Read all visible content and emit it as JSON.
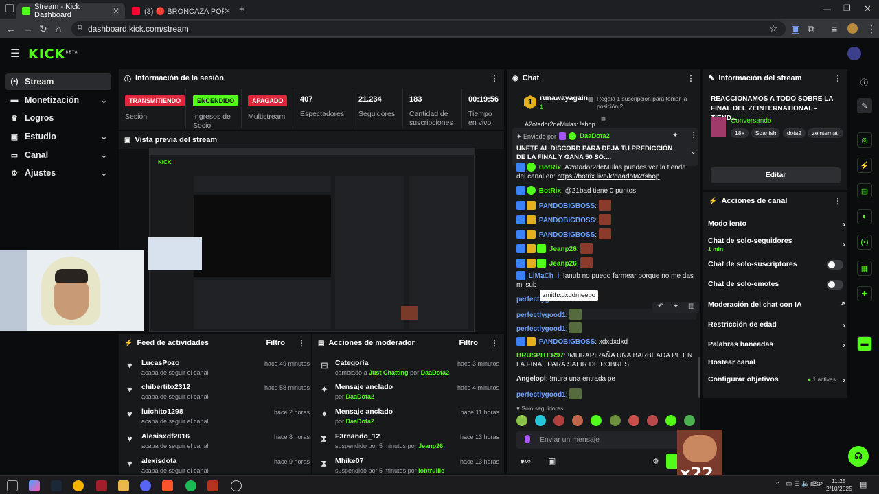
{
  "browser": {
    "tabs": [
      {
        "title": "Stream - Kick Dashboard"
      },
      {
        "title": "(3) 🔴 BRONCAZA POR EL ZEIN"
      }
    ],
    "url": "dashboard.kick.com/stream"
  },
  "sidebar": {
    "items": [
      {
        "label": "Stream"
      },
      {
        "label": "Monetización"
      },
      {
        "label": "Logros"
      },
      {
        "label": "Estudio"
      },
      {
        "label": "Canal"
      },
      {
        "label": "Ajustes"
      }
    ]
  },
  "session": {
    "title": "Información de la sesión",
    "badges": [
      {
        "label": "TRANSMITIENDO",
        "caption": "Sesión",
        "color": "#e0263a"
      },
      {
        "label": "ENCENDIDO",
        "caption": "Ingresos de Socio",
        "color": "#53fc18"
      },
      {
        "label": "APAGADO",
        "caption": "Multistream",
        "color": "#e0263a"
      }
    ],
    "stats": [
      {
        "value": "407",
        "caption": "Espectadores"
      },
      {
        "value": "21.234",
        "caption": "Seguidores"
      },
      {
        "value": "183",
        "caption": "Cantidad de suscripciones"
      },
      {
        "value": "00:19:56",
        "caption": "Tiempo en vivo"
      }
    ]
  },
  "preview": {
    "title": "Vista previa del stream"
  },
  "feed": {
    "title": "Feed de actividades",
    "filter": "Filtro",
    "items": [
      {
        "name": "LucasPozo",
        "sub": "acaba de seguir el canal",
        "time": "hace 49 minutos"
      },
      {
        "name": "chibertito2312",
        "sub": "acaba de seguir el canal",
        "time": "hace 58 minutos"
      },
      {
        "name": "luichito1298",
        "sub": "acaba de seguir el canal",
        "time": "hace 2 horas"
      },
      {
        "name": "Alesisxdf2016",
        "sub": "acaba de seguir el canal",
        "time": "hace 8 horas"
      },
      {
        "name": "alexisdota",
        "sub": "acaba de seguir el canal",
        "time": "hace 9 horas"
      }
    ]
  },
  "mod": {
    "title": "Acciones de moderador",
    "filter": "Filtro",
    "items": [
      {
        "name": "Categoría",
        "pre": "cambiado a",
        "hl": "Just Chatting",
        "mid": "por",
        "user": "DaaDota2",
        "time": "hace 3 minutos",
        "icon": "⊟"
      },
      {
        "name": "Mensaje anclado",
        "pre": "por",
        "hl": "",
        "mid": "",
        "user": "DaaDota2",
        "time": "hace 4 minutos",
        "icon": "📌"
      },
      {
        "name": "Mensaje anclado",
        "pre": "por",
        "hl": "",
        "mid": "",
        "user": "DaaDota2",
        "time": "hace 11 horas",
        "icon": "📌"
      },
      {
        "name": "F3rnando_12",
        "pre": "suspendido por 5 minutos por",
        "hl": "",
        "mid": "",
        "user": "Jeanp26",
        "time": "hace 13 horas",
        "icon": "⧗"
      },
      {
        "name": "Mhike07",
        "pre": "suspendido por 5 minutos por",
        "hl": "",
        "mid": "",
        "user": "lobtruille",
        "time": "hace 13 horas",
        "icon": "⧗"
      }
    ]
  },
  "chat": {
    "title": "Chat",
    "gift_user": "runawayagain",
    "gift_count": "1",
    "gift_text": "Regala 1 suscripción para tomar la posición 2",
    "pinned_label": "Enviado por",
    "pinned_user": "DaaDota2",
    "pinned_msg": "UNETE AL DISCORD PARA DEJA TU PREDICCIÓN DE LA FINAL Y GANA 50 SO:...",
    "top_partial": "A2otador2deMulas: !shop",
    "messages": [
      {
        "user": "BotRix",
        "color": "#53fc18",
        "text": "A2otador2deMulas puedes ver la tienda del canal en:",
        "link": "https://botrix.live/k/daadota2/shop"
      },
      {
        "user": "BotRix",
        "color": "#53fc18",
        "text": "@21bad tiene 0 puntos.",
        "link": ""
      },
      {
        "user": "PANDOBIGBOSS",
        "color": "#6aa0ff",
        "text": "",
        "link": ""
      },
      {
        "user": "PANDOBIGBOSS",
        "color": "#6aa0ff",
        "text": "",
        "link": ""
      },
      {
        "user": "PANDOBIGBOSS",
        "color": "#6aa0ff",
        "text": "",
        "link": ""
      },
      {
        "user": "Jeanp26",
        "color": "#53fc18",
        "text": "",
        "link": ""
      },
      {
        "user": "Jeanp26",
        "color": "#53fc18",
        "text": "",
        "link": ""
      },
      {
        "user": "LiMaCh_i",
        "color": "#6aa0ff",
        "text": "!anub no puedo farmear porque no me das mi sub",
        "link": ""
      },
      {
        "user": "perfectlygood1",
        "color": "#6aa0ff",
        "text": "",
        "link": ""
      },
      {
        "user": "perfectlygood1",
        "color": "#6aa0ff",
        "text": "",
        "link": ""
      },
      {
        "user": "perfectlygood1",
        "color": "#6aa0ff",
        "text": "",
        "link": ""
      },
      {
        "user": "PANDOBIGBOSS",
        "color": "#6aa0ff",
        "text": "xdxdxdxd",
        "link": ""
      },
      {
        "user": "BRUSPITER97",
        "color": "#53fc18",
        "text": "!MURAPIRAÑA UNA BARBEADA PE EN LA FINAL PARA SALIR DE POBRES",
        "link": ""
      },
      {
        "user": "Angelopl",
        "color": "#e6e6e6",
        "text": "!mura una entrada pe",
        "link": ""
      },
      {
        "user": "perfectlygood1",
        "color": "#6aa0ff",
        "text": "",
        "link": ""
      }
    ],
    "tooltip": "zmithxdxddmeepo",
    "followers_only": "Solo seguidores",
    "input_placeholder": "Enviar un mensaje",
    "overlay_text": "x22"
  },
  "stream_info": {
    "title": "Información del stream",
    "stream_title": "REACCIONAMOS A TODO SOBRE LA FINAL DEL ZEINTERNATIONAL - TIEND...",
    "category": "Conversando",
    "tags": [
      "18+",
      "Spanish",
      "dota2",
      "zeinternati"
    ],
    "edit": "Editar"
  },
  "channel_actions": {
    "title": "Acciones de canal",
    "items": [
      {
        "label": "Modo lento",
        "sub": "",
        "kind": "chevron"
      },
      {
        "label": "Chat de solo-seguidores",
        "sub": "1 min",
        "kind": "chevron"
      },
      {
        "label": "Chat de solo-suscriptores",
        "sub": "",
        "kind": "toggle"
      },
      {
        "label": "Chat de solo-emotes",
        "sub": "",
        "kind": "toggle"
      },
      {
        "label": "Moderación del chat con IA",
        "sub": "",
        "kind": "external"
      },
      {
        "label": "Restricción de edad",
        "sub": "",
        "kind": "chevron"
      },
      {
        "label": "Palabras baneadas",
        "sub": "",
        "kind": "chevron"
      },
      {
        "label": "Hostear canal",
        "sub": "",
        "kind": "none"
      },
      {
        "label": "Configurar objetivos",
        "sub": "1 activas",
        "kind": "chevron"
      }
    ]
  },
  "taskbar": {
    "lang": "ESP",
    "time": "11:25",
    "date": "2/10/2025"
  },
  "colors": {
    "accent": "#53fc18",
    "live_red": "#e0263a",
    "panel": "#18191b",
    "bg": "#0b0c0d"
  }
}
